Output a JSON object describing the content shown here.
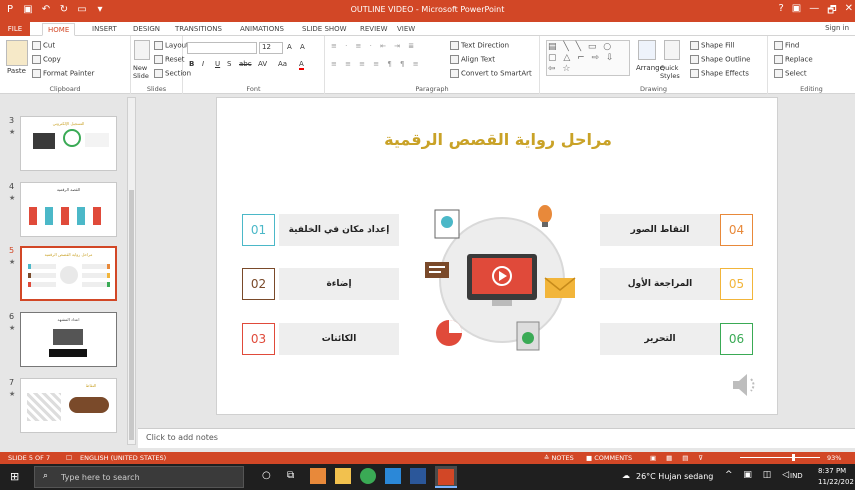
{
  "window": {
    "title": "OUTLINE VIDEO - Microsoft PowerPoint",
    "help": "?",
    "restore": "▣",
    "minimize": "—",
    "maximize": "🗗",
    "close": "✕"
  },
  "tabs": [
    "FILE",
    "HOME",
    "INSERT",
    "DESIGN",
    "TRANSITIONS",
    "ANIMATIONS",
    "SLIDE SHOW",
    "REVIEW",
    "VIEW"
  ],
  "signin": "Sign in",
  "ribbon": {
    "clipboard": {
      "paste": "Paste",
      "cut": "Cut",
      "copy": "Copy",
      "format_painter": "Format Painter",
      "label": "Clipboard"
    },
    "slides": {
      "new_slide": "New Slide",
      "layout": "Layout",
      "reset": "Reset",
      "section": "Section",
      "label": "Slides"
    },
    "font": {
      "size": "12",
      "bold": "B",
      "italic": "I",
      "underline": "U",
      "strike": "S",
      "shadow": "abc",
      "spacing": "AV",
      "case": "Aa",
      "color": "A",
      "label": "Font"
    },
    "paragraph": {
      "text_direction": "Text Direction",
      "align_text": "Align Text",
      "convert": "Convert to SmartArt",
      "label": "Paragraph"
    },
    "drawing": {
      "arrange": "Arrange",
      "quick_styles": "Quick Styles",
      "fill": "Shape Fill",
      "outline": "Shape Outline",
      "effects": "Shape Effects",
      "label": "Drawing"
    },
    "editing": {
      "find": "Find",
      "replace": "Replace",
      "select": "Select",
      "label": "Editing"
    }
  },
  "thumbnails": [
    {
      "num": "3",
      "star": "★",
      "title": "التسجيل الإلكتروني"
    },
    {
      "num": "4",
      "star": "★",
      "title": "القصة الرقمية"
    },
    {
      "num": "5",
      "star": "★",
      "title": "مراحل رواية القصص الرقمية"
    },
    {
      "num": "6",
      "star": "★",
      "title": "اعداد المشهد"
    },
    {
      "num": "7",
      "star": "★",
      "title": "النقاط"
    }
  ],
  "slide": {
    "title": "مراحل رواية القصص الرقمية",
    "left_items": [
      {
        "num": "01",
        "label": "إعداد مكان في الخلفية",
        "color": "#4bb8c8"
      },
      {
        "num": "02",
        "label": "إضاءة",
        "color": "#7a4a2a"
      },
      {
        "num": "03",
        "label": "الكائنات",
        "color": "#e04a3a"
      }
    ],
    "right_items": [
      {
        "num": "04",
        "label": "التقاط الصور",
        "color": "#e8893a"
      },
      {
        "num": "05",
        "label": "المراجعة الأول",
        "color": "#f2b53a"
      },
      {
        "num": "06",
        "label": "التحرير",
        "color": "#3aaa55"
      }
    ]
  },
  "notes_placeholder": "Click to add notes",
  "status": {
    "slide": "SLIDE 5 OF 7",
    "lang": "ENGLISH (UNITED STATES)",
    "notes": "≙ NOTES",
    "comments": "COMMENTS",
    "zoom": "93%"
  },
  "taskbar": {
    "search": "Type here to search",
    "weather": "26°C Hujan sedang",
    "lang": "IND",
    "time": "8:37 PM",
    "date": "11/22/202"
  }
}
